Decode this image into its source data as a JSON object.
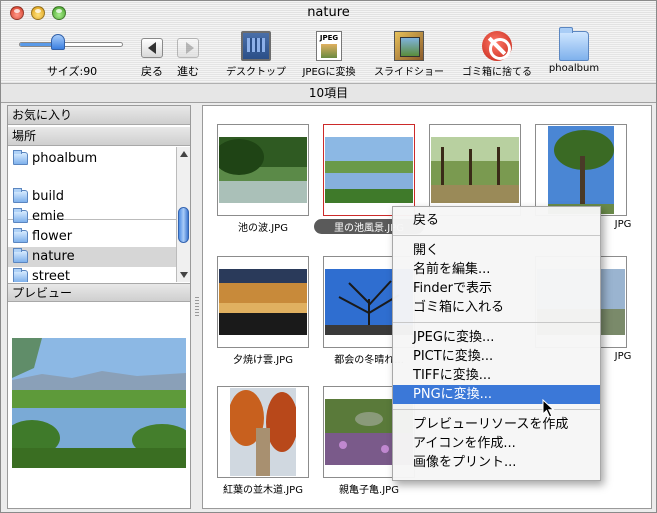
{
  "window": {
    "title": "nature"
  },
  "toolbar": {
    "size_label": "サイズ:90",
    "size_value": 0.35,
    "back_label": "戻る",
    "forward_label": "進む",
    "items": [
      {
        "label": "デスクトップ",
        "icon": "desktop-icon"
      },
      {
        "label": "JPEGに変換",
        "icon": "jpeg-convert-icon"
      },
      {
        "label": "スライドショー",
        "icon": "slideshow-icon"
      },
      {
        "label": "ゴミ箱に捨てる",
        "icon": "trash-icon"
      },
      {
        "label": "phoalbum",
        "icon": "folder-icon"
      }
    ]
  },
  "status": {
    "item_count": "10項目"
  },
  "sidebar": {
    "favorites_label": "お気に入り",
    "locations_label": "場所",
    "preview_label": "プレビュー",
    "locations": [
      {
        "name": "phoalbum"
      },
      {
        "name": "build"
      },
      {
        "name": "emie"
      },
      {
        "name": "flower"
      },
      {
        "name": "nature",
        "selected": true
      },
      {
        "name": "street"
      }
    ]
  },
  "files": [
    {
      "name": "池の波.JPG"
    },
    {
      "name": "里の池風景.JPG"
    },
    {
      "name": ""
    },
    {
      "name": "JPG"
    },
    {
      "name": "夕焼け雲.JPG"
    },
    {
      "name": "都会の冬晴れ..."
    },
    {
      "name": ""
    },
    {
      "name": "JPG"
    },
    {
      "name": "紅葉の並木道.JPG"
    },
    {
      "name": "親亀子亀.JPG"
    }
  ],
  "context_menu": {
    "items": [
      {
        "label": "戻る"
      },
      {
        "label": "開く"
      },
      {
        "label": "名前を編集..."
      },
      {
        "label": "Finderで表示"
      },
      {
        "label": "ゴミ箱に入れる"
      },
      {
        "label": "JPEGに変換..."
      },
      {
        "label": "PICTに変換..."
      },
      {
        "label": "TIFFに変換..."
      },
      {
        "label": "PNGに変換...",
        "highlighted": true
      },
      {
        "label": "プレビューリソースを作成"
      },
      {
        "label": "アイコンを作成..."
      },
      {
        "label": "画像をプリント..."
      }
    ]
  },
  "colors": {
    "selection_blue": "#3b78d8",
    "selected_border": "#cc2a2a"
  }
}
